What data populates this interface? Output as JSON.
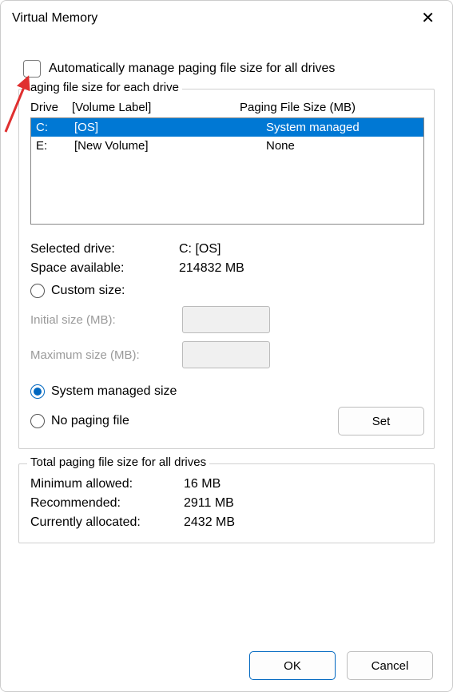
{
  "title": "Virtual Memory",
  "auto_label": "Automatically manage paging file size for all drives",
  "group1_legend": "aging file size for each drive",
  "headers": {
    "drive": "Drive",
    "vol": "[Volume Label]",
    "pfs": "Paging File Size (MB)"
  },
  "drives": [
    {
      "drive": "C:",
      "vol": "[OS]",
      "pfs": "System managed",
      "selected": true
    },
    {
      "drive": "E:",
      "vol": "[New Volume]",
      "pfs": "None",
      "selected": false
    }
  ],
  "selected_drive_label": "Selected drive:",
  "selected_drive_value": "C:  [OS]",
  "space_available_label": "Space available:",
  "space_available_value": "214832 MB",
  "custom_size_label": "Custom size:",
  "initial_size_label": "Initial size (MB):",
  "maximum_size_label": "Maximum size (MB):",
  "system_managed_label": "System managed size",
  "no_paging_label": "No paging file",
  "set_label": "Set",
  "group2_legend": "Total paging file size for all drives",
  "min_allowed_label": "Minimum allowed:",
  "min_allowed_value": "16 MB",
  "recommended_label": "Recommended:",
  "recommended_value": "2911 MB",
  "currently_label": "Currently allocated:",
  "currently_value": "2432 MB",
  "ok_label": "OK",
  "cancel_label": "Cancel"
}
